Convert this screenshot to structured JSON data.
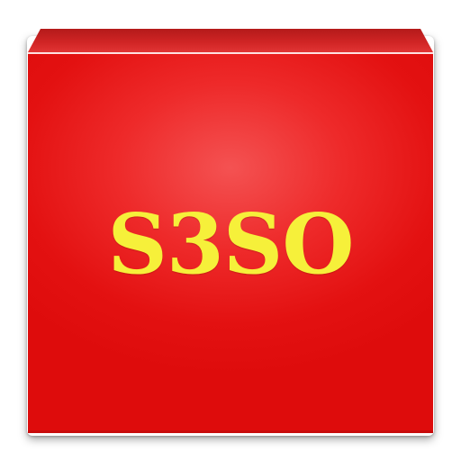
{
  "app_icon": {
    "label": "S3SO",
    "colors": {
      "tile": "#e31111",
      "tile_highlight": "#f45252",
      "text": "#f6f03a",
      "background": "#ffffff"
    }
  }
}
